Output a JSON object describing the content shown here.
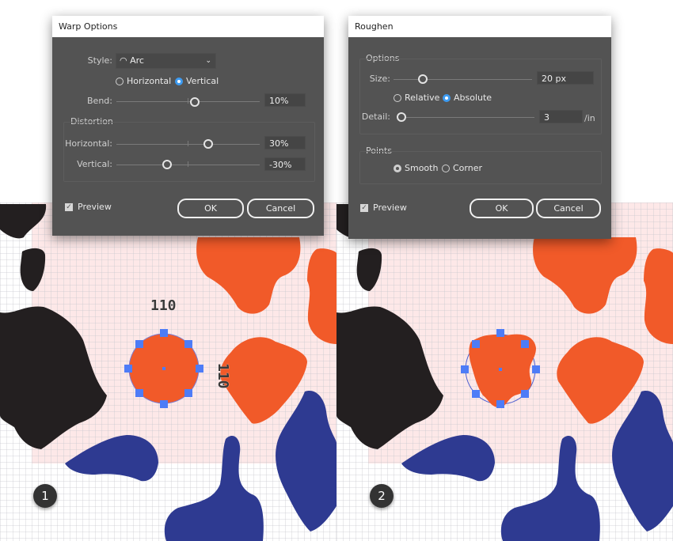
{
  "colors": {
    "orange": "#f15a29",
    "black": "#231f20",
    "blue": "#2e3a91",
    "selection": "#4d7cf7",
    "dialog_bg": "#535353",
    "radio_on": "#3d9bf1",
    "artboard": "#fde8e8"
  },
  "panels": [
    {
      "step": "1",
      "width_label": "110",
      "height_label": "110"
    },
    {
      "step": "2"
    }
  ],
  "warp": {
    "title": "Warp Options",
    "style_label": "Style:",
    "style_value": "Arc",
    "style_icon": "arc-icon",
    "orientation": [
      {
        "label": "Horizontal",
        "selected": false
      },
      {
        "label": "Vertical",
        "selected": true
      }
    ],
    "bend_label": "Bend:",
    "bend_value": "10%",
    "bend": 10,
    "distortion_title": "Distortion",
    "horizontal_label": "Horizontal:",
    "horizontal_value": "30%",
    "horizontal": 30,
    "vertical_label": "Vertical:",
    "vertical_value": "-30%",
    "vertical": -30,
    "preview_label": "Preview",
    "preview_checked": true,
    "ok_label": "OK",
    "cancel_label": "Cancel"
  },
  "roughen": {
    "title": "Roughen",
    "options_title": "Options",
    "size_label": "Size:",
    "size_value": "20 px",
    "mode": [
      {
        "label": "Relative",
        "selected": false
      },
      {
        "label": "Absolute",
        "selected": true
      }
    ],
    "detail_label": "Detail:",
    "detail_value": "3",
    "detail_unit": "/in",
    "points_title": "Points",
    "points": [
      {
        "label": "Smooth",
        "selected": true
      },
      {
        "label": "Corner",
        "selected": false
      }
    ],
    "preview_label": "Preview",
    "preview_checked": true,
    "ok_label": "OK",
    "cancel_label": "Cancel"
  }
}
